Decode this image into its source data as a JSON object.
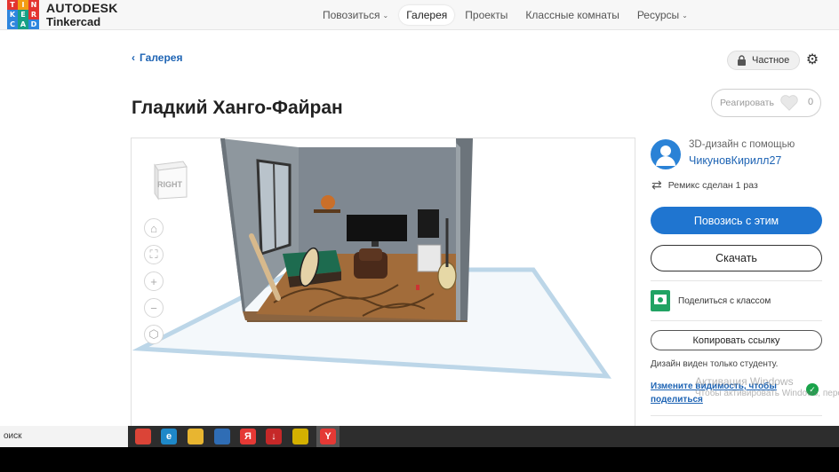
{
  "brand": {
    "logo_letters": [
      "T",
      "I",
      "N",
      "K",
      "E",
      "R",
      "C",
      "A",
      "D"
    ],
    "logo_colors": [
      "#e3342f",
      "#f39c12",
      "#e3342f",
      "#2e86de",
      "#16a085",
      "#e3342f",
      "#2e86de",
      "#16a085",
      "#2e86de"
    ],
    "line1": "AUTODESK",
    "line2": "Tinkercad"
  },
  "nav": {
    "items": [
      {
        "label": "Повозиться",
        "has_chevron": true
      },
      {
        "label": "Галерея",
        "active": true
      },
      {
        "label": "Проекты"
      },
      {
        "label": "Классные комнаты"
      },
      {
        "label": "Ресурсы",
        "has_chevron": true
      }
    ]
  },
  "breadcrumb": {
    "label": "Галерея"
  },
  "privacy": {
    "label": "Частное",
    "icon": "lock-icon"
  },
  "title": "Гладкий Ханго-Файран",
  "react": {
    "label": "Реагировать",
    "count": "0"
  },
  "viewer": {
    "viewcube_label": "RIGHT",
    "controls": [
      {
        "name": "home-view-icon",
        "glyph": "⌂"
      },
      {
        "name": "fit-view-icon",
        "glyph": "⛶"
      },
      {
        "name": "zoom-in-icon",
        "glyph": "+"
      },
      {
        "name": "zoom-out-icon",
        "glyph": "−"
      },
      {
        "name": "perspective-icon",
        "glyph": "⬡"
      }
    ]
  },
  "sidebar": {
    "designed_with": "3D-дизайн с помощью",
    "author": "ЧикуновКирилл27",
    "remix": "Ремикс сделан 1 раз",
    "tinker_button": "Повозись с этим",
    "download_button": "Скачать",
    "share_classroom": "Поделиться с классом",
    "copy_link_button": "Копировать ссылку",
    "visible_note": "Дизайн виден только студенту.",
    "visibility_link": "Измените видимость, чтобы поделиться"
  },
  "watermark": {
    "line1": "Активация Windows",
    "line2": "Чтобы активировать Windows, перейд"
  },
  "taskbar": {
    "search": "оиск",
    "apps": [
      {
        "name": "chrome-icon",
        "glyph": "",
        "color": "#db4437"
      },
      {
        "name": "edge-icon",
        "glyph": "e",
        "color": "#1e88c8"
      },
      {
        "name": "file-explorer-icon",
        "glyph": "",
        "color": "#e8b530"
      },
      {
        "name": "store-icon",
        "glyph": "",
        "color": "#2f6db5"
      },
      {
        "name": "yandex-icon",
        "glyph": "Я",
        "color": "#e53935"
      },
      {
        "name": "download-app-icon",
        "glyph": "↓",
        "color": "#c62828"
      },
      {
        "name": "game-app-icon",
        "glyph": "",
        "color": "#d4b000"
      },
      {
        "name": "yandex-browser-icon",
        "glyph": "Y",
        "color": "#e53935"
      }
    ]
  }
}
